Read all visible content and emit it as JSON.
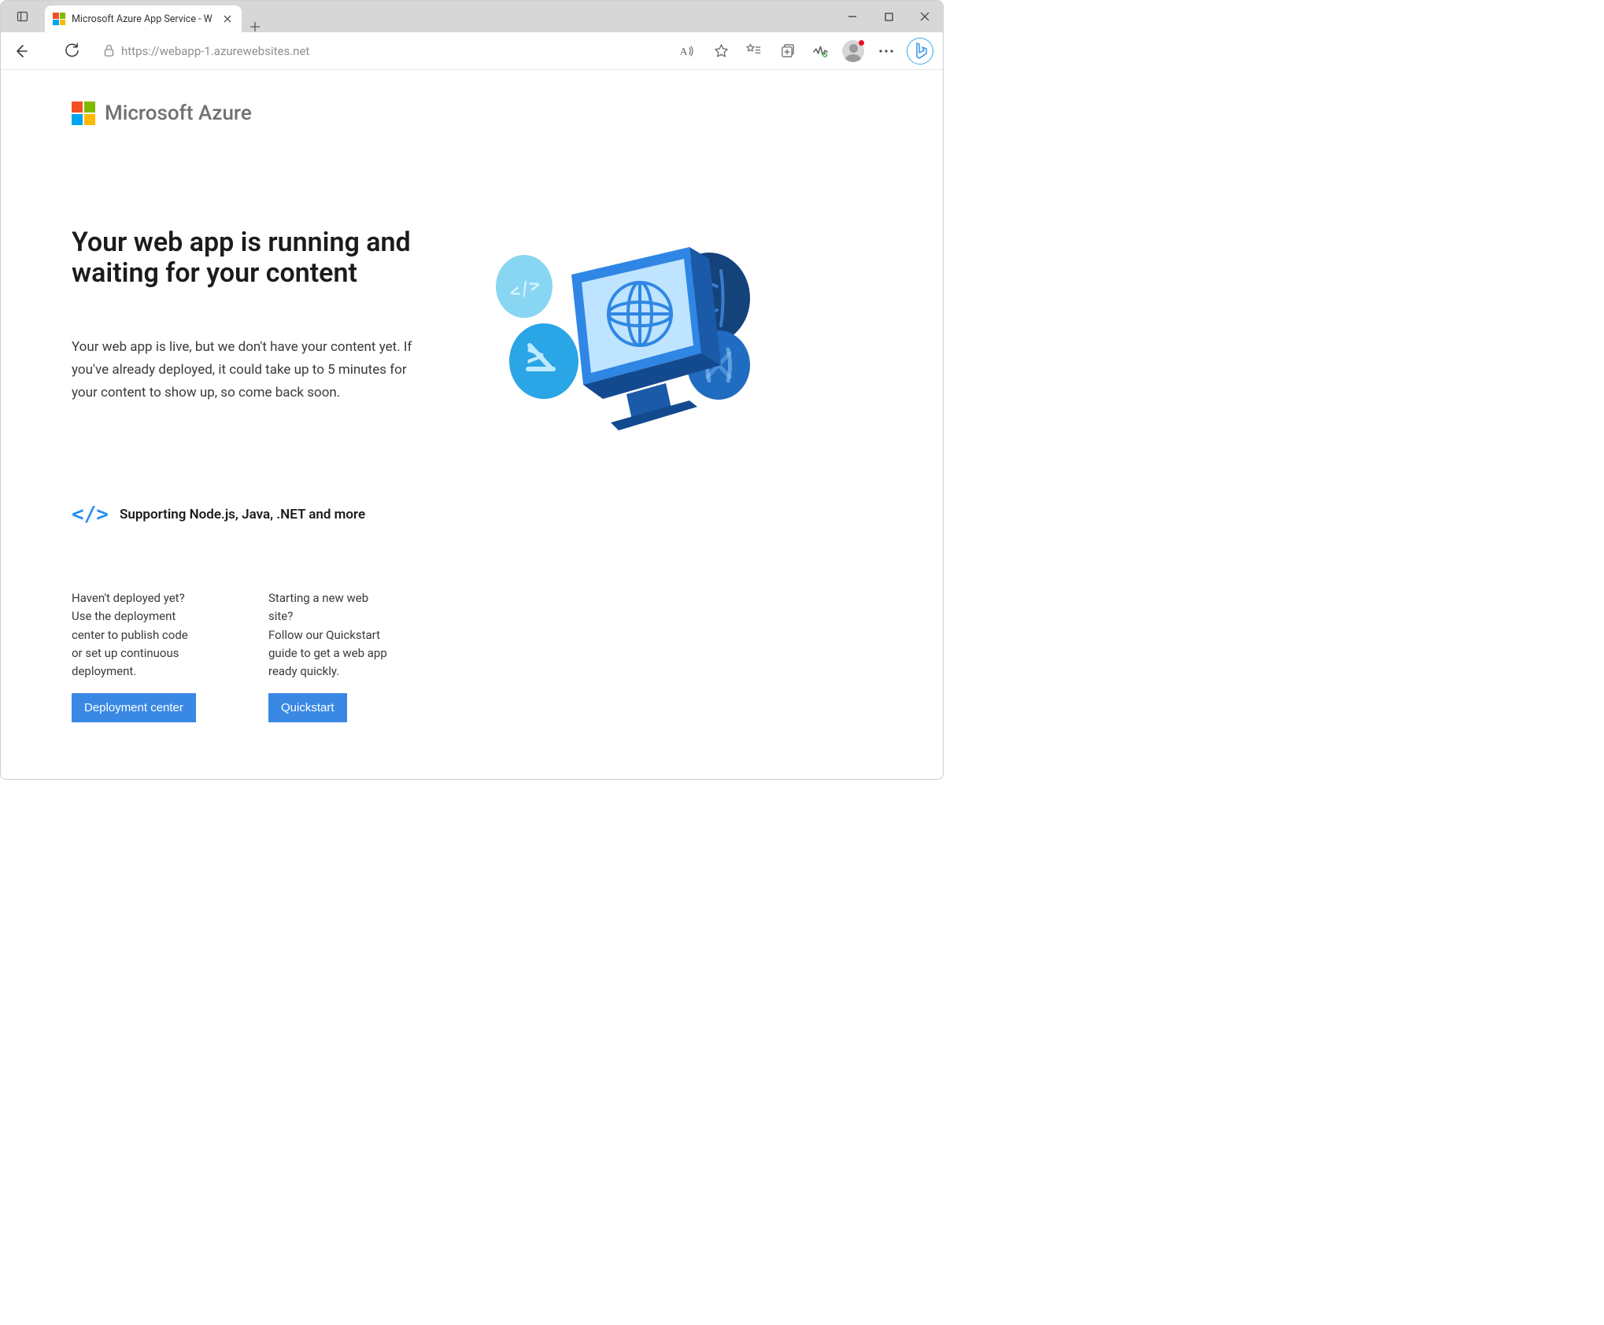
{
  "browser": {
    "tab_title": "Microsoft Azure App Service - W",
    "url": "https://webapp-1.azurewebsites.net"
  },
  "page": {
    "brand": "Microsoft Azure",
    "hero_title": "Your web app is running and waiting for your content",
    "hero_description": "Your web app is live, but we don't have your content yet. If you've already deployed, it could take up to 5 minutes for your content to show up, so come back soon.",
    "supporting_text": "Supporting Node.js, Java, .NET and more",
    "cards": [
      {
        "text": "Haven't deployed yet?\nUse the deployment center to publish code or set up continuous deployment.",
        "button_label": "Deployment center"
      },
      {
        "text": "Starting a new web site?\nFollow our Quickstart guide to get a web app ready quickly.",
        "button_label": "Quickstart"
      }
    ]
  }
}
